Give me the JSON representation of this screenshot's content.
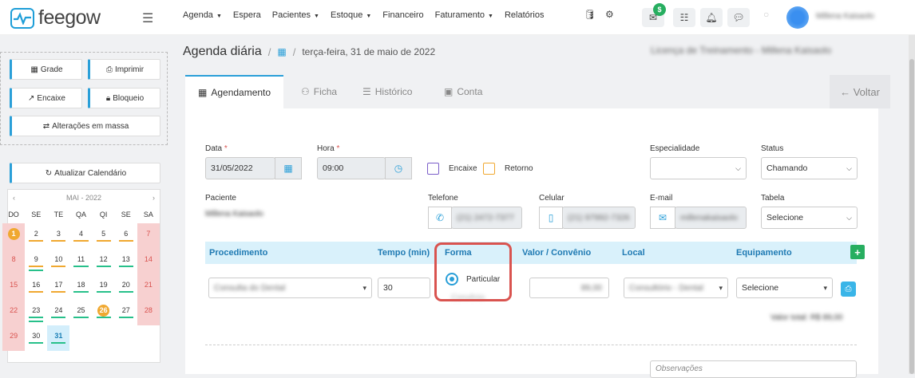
{
  "brand": {
    "name": "feegow"
  },
  "nav": {
    "items": [
      {
        "label": "Agenda",
        "caret": true
      },
      {
        "label": "Espera",
        "caret": false
      },
      {
        "label": "Pacientes",
        "caret": true
      },
      {
        "label": "Estoque",
        "caret": true
      },
      {
        "label": "Financeiro",
        "caret": false
      },
      {
        "label": "Faturamento",
        "caret": true
      },
      {
        "label": "Relatórios",
        "caret": false
      }
    ],
    "messages_badge": "$"
  },
  "breadcrumb": {
    "title": "Agenda diária",
    "date": "terça-feira, 31 de maio de 2022",
    "right_text": "Licença de Treinamento - Millena Kaisaolo"
  },
  "user": {
    "name": "Millena Kaisaolo"
  },
  "left": {
    "grade": "Grade",
    "imprimir": "Imprimir",
    "encaixe": "Encaixe",
    "bloqueio": "Bloqueio",
    "alteracoes": "Alterações em massa",
    "atualizar": "Atualizar Calendário"
  },
  "calendar": {
    "month_label": "MAI - 2022",
    "dow": [
      "DO",
      "SE",
      "TE",
      "QA",
      "QI",
      "SE",
      "SA"
    ],
    "weeks": [
      [
        "1",
        "2",
        "3",
        "4",
        "5",
        "6",
        "7"
      ],
      [
        "8",
        "9",
        "10",
        "11",
        "12",
        "13",
        "14"
      ],
      [
        "15",
        "16",
        "17",
        "18",
        "19",
        "20",
        "21"
      ],
      [
        "22",
        "23",
        "24",
        "25",
        "26",
        "27",
        "28"
      ],
      [
        "29",
        "30",
        "31",
        "",
        "",
        "",
        ""
      ]
    ],
    "highlighted_days": [
      "1",
      "26"
    ],
    "selected_day": "31",
    "colors": {
      "orange": "#f0a830",
      "green": "#27c08a",
      "weekend": "#f7d0d0"
    }
  },
  "tabs": [
    {
      "label": "Agendamento",
      "active": true
    },
    {
      "label": "Ficha",
      "active": false
    },
    {
      "label": "Histórico",
      "active": false
    },
    {
      "label": "Conta",
      "active": false
    }
  ],
  "voltar": "Voltar",
  "form": {
    "data_label": "Data",
    "data_value": "31/05/2022",
    "hora_label": "Hora",
    "hora_value": "09:00",
    "encaixe_label": "Encaixe",
    "retorno_label": "Retorno",
    "especialidade_label": "Especialidade",
    "especialidade_value": "",
    "status_label": "Status",
    "status_value": "Chamando",
    "paciente_label": "Paciente",
    "paciente_value": "Millena Kaisaolo",
    "telefone_label": "Telefone",
    "telefone_value": "(21) 2472-7377",
    "celular_label": "Celular",
    "celular_value": "(21) 97992-7326",
    "email_label": "E-mail",
    "email_value": "millenakaisaolo",
    "tabela_label": "Tabela",
    "tabela_value": "Selecione"
  },
  "procedimento": {
    "headers": {
      "procedimento": "Procedimento",
      "tempo": "Tempo (min)",
      "forma": "Forma",
      "valor": "Valor / Convênio",
      "local": "Local",
      "equipamento": "Equipamento"
    },
    "row": {
      "procedimento": "Consulta do Dental",
      "tempo": "30",
      "forma_option": "Particular",
      "forma_option2": "Convênio",
      "valor": "89,00",
      "local": "Consultório - Dental",
      "equipamento": "Selecione"
    },
    "total": "Valor total: R$ 89,00"
  },
  "observacoes_placeholder": "Observações"
}
